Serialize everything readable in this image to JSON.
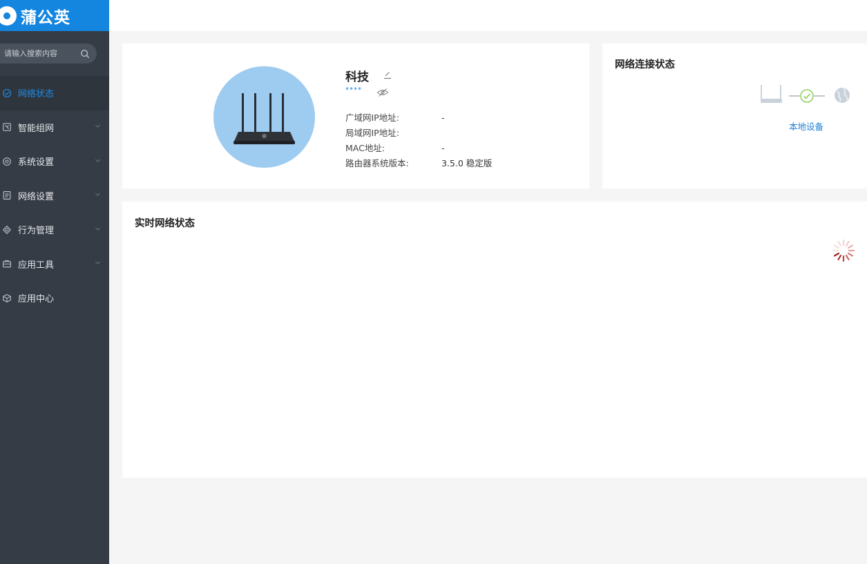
{
  "brand": {
    "name": "蒲公英"
  },
  "search": {
    "placeholder": "请输入搜索内容"
  },
  "sidebar": {
    "items": [
      {
        "label": "网络状态",
        "icon": "network-status-icon",
        "active": true,
        "expandable": false
      },
      {
        "label": "智能组网",
        "icon": "smart-network-icon",
        "active": false,
        "expandable": true
      },
      {
        "label": "系统设置",
        "icon": "settings-icon",
        "active": false,
        "expandable": true
      },
      {
        "label": "网络设置",
        "icon": "document-icon",
        "active": false,
        "expandable": true
      },
      {
        "label": "行为管理",
        "icon": "behavior-icon",
        "active": false,
        "expandable": true
      },
      {
        "label": "应用工具",
        "icon": "toolbox-icon",
        "active": false,
        "expandable": true
      },
      {
        "label": "应用中心",
        "icon": "cube-icon",
        "active": false,
        "expandable": false
      }
    ]
  },
  "device": {
    "name": "科技",
    "password_mask": "****",
    "info": [
      {
        "label": "广域网IP地址:",
        "value": "-"
      },
      {
        "label": "局域网IP地址:",
        "value": ""
      },
      {
        "label": "MAC地址:",
        "value": "-"
      },
      {
        "label": "路由器系统版本:",
        "value": "3.5.0 稳定版"
      }
    ]
  },
  "connection": {
    "title": "网络连接状态",
    "local_device_label": "本地设备"
  },
  "realtime": {
    "title": "实时网络状态"
  },
  "colors": {
    "brand_blue": "#1486e0",
    "sidebar_bg": "#353c46",
    "active_text": "#1e8be6",
    "router_circle": "#9ecbf0",
    "ok_green": "#7ac943"
  }
}
